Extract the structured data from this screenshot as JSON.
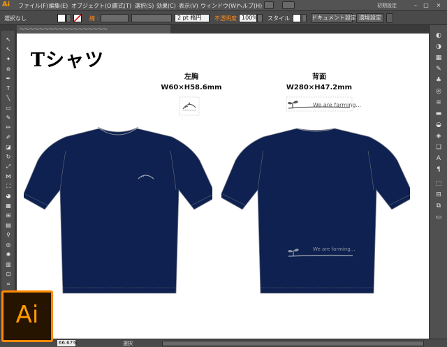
{
  "app": {
    "logo": "Ai",
    "menu": [
      "ファイル(F)",
      "編集(E)",
      "オブジェクト(O)",
      "書式(T)",
      "選択(S)",
      "効果(C)",
      "表示(V)",
      "ウィンドウ(W)",
      "ヘルプ(H)"
    ],
    "workspace": "初期設定",
    "window_controls": [
      "–",
      "□",
      "×"
    ]
  },
  "controlbar": {
    "selection_label": "選択なし",
    "stroke_label": "線 :",
    "stroke_weight": "2 pt 楕円",
    "opacity_label": "不透明度",
    "opacity_value": "100%",
    "style_label": "スタイル :",
    "doc_setup_button": "ドキュメント設定",
    "env_setup_button": "環境設定"
  },
  "tab": {
    "label": "～～～～～～～～～～～～～～～～～～"
  },
  "artboard": {
    "title": "Tシャツ",
    "left_print": {
      "name": "左胸",
      "size": "W60×H58.6mm"
    },
    "back_print": {
      "name": "背面",
      "size": "W280×H47.2mm",
      "logo_text": "We are farming..."
    },
    "garment_color": "#0e2150"
  },
  "statusbar": {
    "zoom": "66.67%",
    "status": "選択"
  },
  "badge": {
    "text": "Ai",
    "accent": "#ff8a00"
  }
}
